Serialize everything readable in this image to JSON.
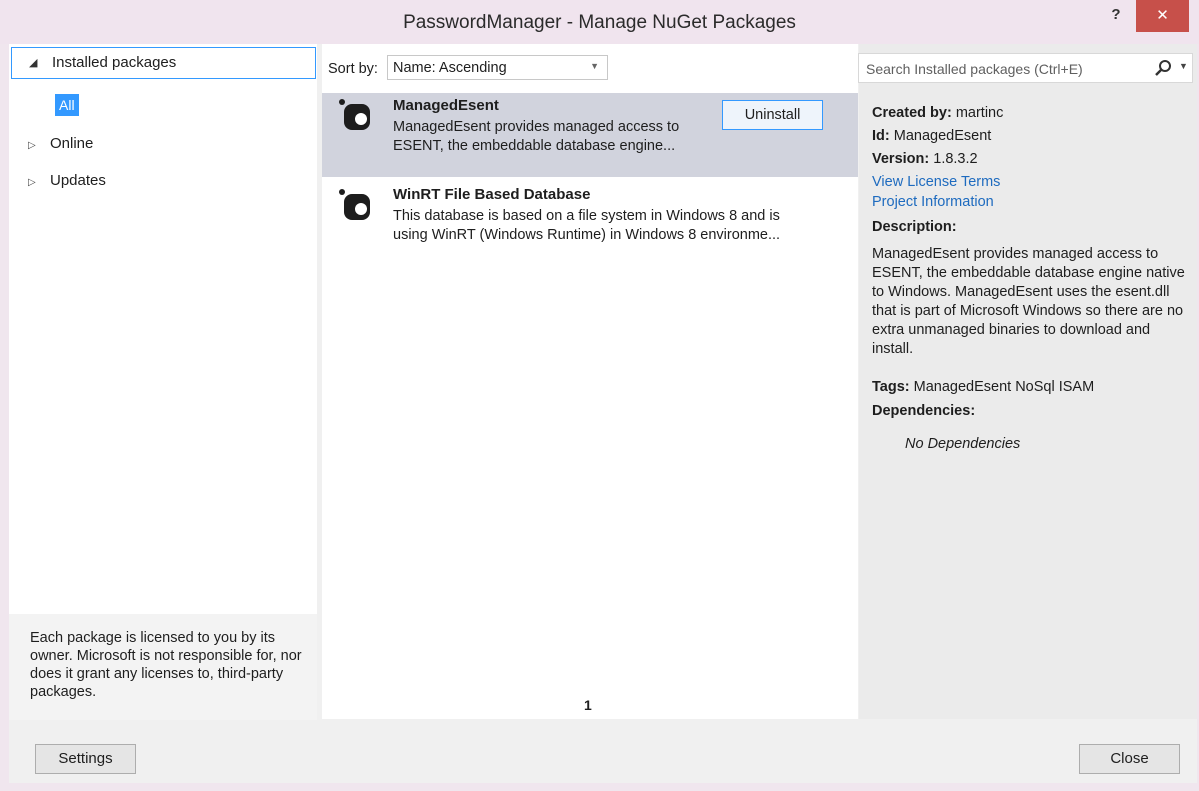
{
  "window": {
    "title": "PasswordManager - Manage NuGet Packages",
    "help_label": "?",
    "close_label": "✕"
  },
  "nav": {
    "installed_label": "Installed packages",
    "all_label": "All",
    "online_label": "Online",
    "updates_label": "Updates",
    "license_text": "Each package is licensed to you by its owner. Microsoft is not responsible for, nor does it grant any licenses to, third-party packages."
  },
  "sort": {
    "label": "Sort by:",
    "value": "Name: Ascending"
  },
  "packages": [
    {
      "name": "ManagedEsent",
      "desc_line1": "ManagedEsent provides managed access to",
      "desc_line2": "ESENT, the embeddable database engine...",
      "action_label": "Uninstall"
    },
    {
      "name": "WinRT File Based Database",
      "desc_line1": "This database is based on a file system in Windows 8 and is",
      "desc_line2": "using WinRT (Windows Runtime) in Windows 8 environme..."
    }
  ],
  "pagination": {
    "current": "1"
  },
  "search": {
    "placeholder": "Search Installed packages (Ctrl+E)"
  },
  "details": {
    "created_by_label": "Created by:",
    "created_by": "martinc",
    "id_label": "Id:",
    "id": "ManagedEsent",
    "version_label": "Version:",
    "version": "1.8.3.2",
    "license_link": "View License Terms",
    "project_link": "Project Information",
    "description_label": "Description:",
    "description": "ManagedEsent provides managed access to ESENT, the embeddable database engine native to Windows. ManagedEsent uses the esent.dll that is part of Microsoft Windows so there are no extra unmanaged binaries to download and install.",
    "tags_label": "Tags:",
    "tags": "ManagedEsent NoSql ISAM",
    "dependencies_label": "Dependencies:",
    "dependencies_value": "No Dependencies"
  },
  "footer": {
    "settings_label": "Settings",
    "close_label": "Close"
  },
  "colors": {
    "accent": "#3399ff",
    "selected_row": "#d1d3dd",
    "link": "#1e6bbf",
    "close_button": "#c7504a"
  }
}
